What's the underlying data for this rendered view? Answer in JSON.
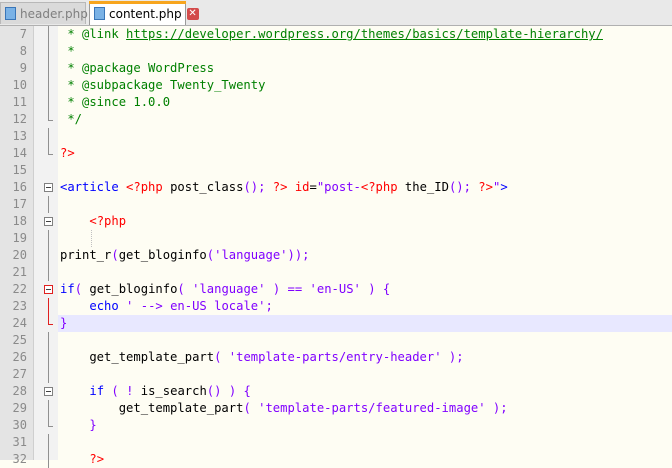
{
  "tabs": [
    {
      "label": "header.php",
      "active": false,
      "close": "✕"
    },
    {
      "label": "content.php",
      "active": true,
      "close": "✕"
    }
  ],
  "colors": {
    "comment": "#008000",
    "php_delim": "#ff0000",
    "html_tag": "#0000ff",
    "attr": "#ff0000",
    "string": "#8000ff",
    "keyword": "#0000ff",
    "editor_bg": "#fefdf3",
    "current_line": "#e8e8ff"
  },
  "editor": {
    "lines": [
      {
        "num": "7",
        "fold": "vline",
        "tokens": [
          [
            "c-comment",
            " * @link "
          ],
          [
            "c-link",
            "https://developer.wordpress.org/themes/basics/template-hierarchy/"
          ]
        ]
      },
      {
        "num": "8",
        "fold": "vline",
        "tokens": [
          [
            "c-comment",
            " *"
          ]
        ]
      },
      {
        "num": "9",
        "fold": "vline",
        "tokens": [
          [
            "c-comment",
            " * @package WordPress"
          ]
        ]
      },
      {
        "num": "10",
        "fold": "vline",
        "tokens": [
          [
            "c-comment",
            " * @subpackage Twenty_Twenty"
          ]
        ]
      },
      {
        "num": "11",
        "fold": "vline",
        "tokens": [
          [
            "c-comment",
            " * @since 1.0.0"
          ]
        ]
      },
      {
        "num": "12",
        "fold": "end",
        "tokens": [
          [
            "c-comment",
            " */"
          ]
        ]
      },
      {
        "num": "13",
        "fold": "vline",
        "tokens": []
      },
      {
        "num": "14",
        "fold": "end",
        "tokens": [
          [
            "c-php",
            "?>"
          ]
        ]
      },
      {
        "num": "15",
        "fold": "",
        "tokens": []
      },
      {
        "num": "16",
        "fold": "box",
        "tokens": [
          [
            "c-tag",
            "<article "
          ],
          [
            "c-php",
            "<?php"
          ],
          [
            "c-fn",
            " post_class"
          ],
          [
            "c-p",
            "();"
          ],
          [
            "c-php",
            " ?>"
          ],
          [
            "c-attr",
            " id"
          ],
          [
            "c-fn",
            "="
          ],
          [
            "c-str",
            "\"post-"
          ],
          [
            "c-php",
            "<?php"
          ],
          [
            "c-fn",
            " the_ID"
          ],
          [
            "c-p",
            "();"
          ],
          [
            "c-php",
            " ?>"
          ],
          [
            "c-str",
            "\""
          ],
          [
            "c-tag",
            ">"
          ]
        ]
      },
      {
        "num": "17",
        "fold": "vline",
        "tokens": []
      },
      {
        "num": "18",
        "fold": "box",
        "tokens": [
          [
            "c-fn",
            "    "
          ],
          [
            "c-php",
            "<?php"
          ]
        ]
      },
      {
        "num": "19",
        "fold": "vline",
        "guide": true,
        "tokens": []
      },
      {
        "num": "20",
        "fold": "vline",
        "tokens": [
          [
            "c-fn",
            "print_r"
          ],
          [
            "c-p",
            "("
          ],
          [
            "c-fn",
            "get_bloginfo"
          ],
          [
            "c-p",
            "("
          ],
          [
            "c-str",
            "'language'"
          ],
          [
            "c-p",
            "));"
          ]
        ]
      },
      {
        "num": "21",
        "fold": "vline",
        "tokens": []
      },
      {
        "num": "22",
        "fold": "box red",
        "tokens": [
          [
            "c-kw",
            "if"
          ],
          [
            "c-p",
            "("
          ],
          [
            "c-fn",
            " get_bloginfo"
          ],
          [
            "c-p",
            "("
          ],
          [
            "c-str",
            " 'language'"
          ],
          [
            "c-p",
            " )"
          ],
          [
            "c-p",
            " =="
          ],
          [
            "c-str",
            " 'en-US'"
          ],
          [
            "c-p",
            " )"
          ],
          [
            "c-p",
            " {"
          ]
        ]
      },
      {
        "num": "23",
        "fold": "vline red",
        "tokens": [
          [
            "c-fn",
            "    "
          ],
          [
            "c-kw",
            "echo"
          ],
          [
            "c-str",
            " ' --> en-US locale'"
          ],
          [
            "c-p",
            ";"
          ]
        ]
      },
      {
        "num": "24",
        "fold": "end red",
        "current": true,
        "tokens": [
          [
            "c-p",
            "}"
          ]
        ]
      },
      {
        "num": "25",
        "fold": "vline",
        "tokens": []
      },
      {
        "num": "26",
        "fold": "vline",
        "tokens": [
          [
            "c-fn",
            "    get_template_part"
          ],
          [
            "c-p",
            "("
          ],
          [
            "c-str",
            " 'template-parts/entry-header'"
          ],
          [
            "c-p",
            " );"
          ]
        ]
      },
      {
        "num": "27",
        "fold": "vline",
        "tokens": []
      },
      {
        "num": "28",
        "fold": "box",
        "tokens": [
          [
            "c-fn",
            "    "
          ],
          [
            "c-kw",
            "if"
          ],
          [
            "c-p",
            " ("
          ],
          [
            "c-p",
            " !"
          ],
          [
            "c-fn",
            " is_search"
          ],
          [
            "c-p",
            "()"
          ],
          [
            "c-p",
            " )"
          ],
          [
            "c-p",
            " {"
          ]
        ]
      },
      {
        "num": "29",
        "fold": "vline",
        "tokens": [
          [
            "c-fn",
            "        get_template_part"
          ],
          [
            "c-p",
            "("
          ],
          [
            "c-str",
            " 'template-parts/featured-image'"
          ],
          [
            "c-p",
            " );"
          ]
        ]
      },
      {
        "num": "30",
        "fold": "end",
        "tokens": [
          [
            "c-fn",
            "    "
          ],
          [
            "c-p",
            "}"
          ]
        ]
      },
      {
        "num": "31",
        "fold": "vline",
        "tokens": []
      },
      {
        "num": "32",
        "fold": "vline",
        "tokens": [
          [
            "c-fn",
            "    "
          ],
          [
            "c-php",
            "?>"
          ]
        ]
      }
    ]
  }
}
